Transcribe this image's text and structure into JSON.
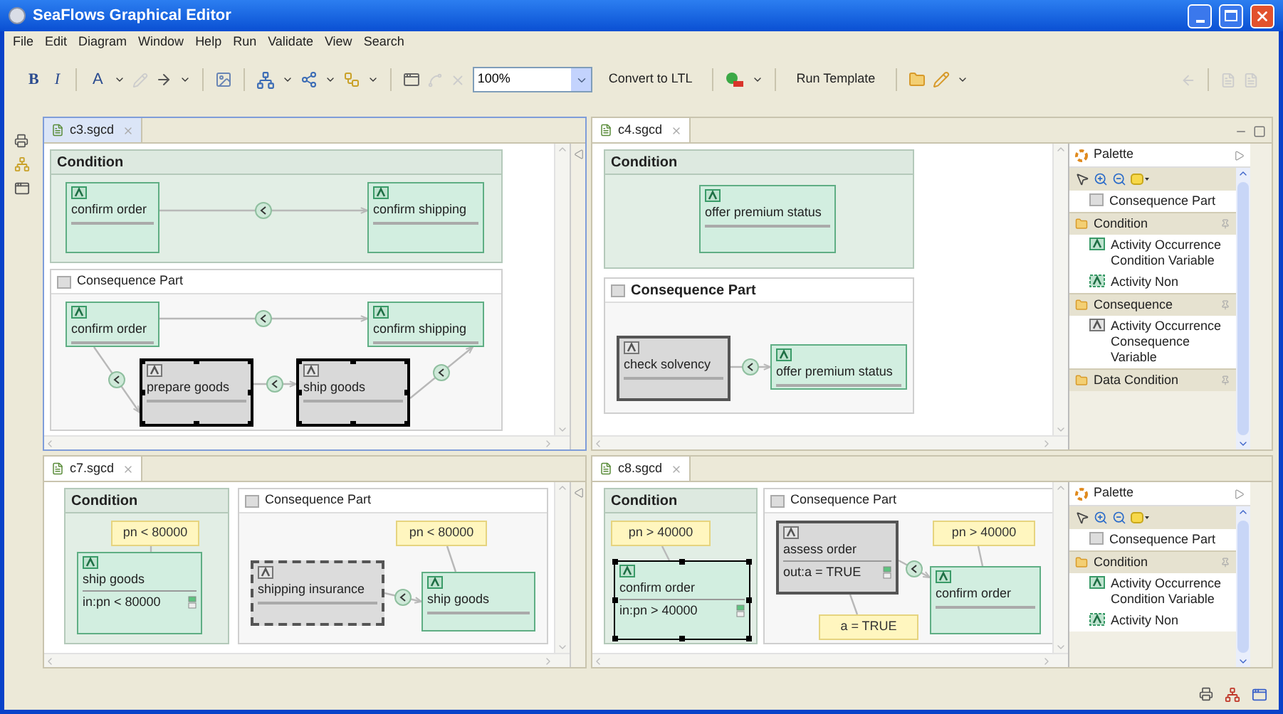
{
  "window": {
    "title": "SeaFlows Graphical Editor"
  },
  "menu": [
    {
      "label": "File"
    },
    {
      "label": "Edit"
    },
    {
      "label": "Diagram"
    },
    {
      "label": "Window"
    },
    {
      "label": "Help"
    },
    {
      "label": "Run"
    },
    {
      "label": "Validate"
    },
    {
      "label": "View"
    },
    {
      "label": "Search"
    }
  ],
  "toolbar": {
    "bold": "B",
    "italic": "I",
    "font_color": "A",
    "zoom": "100%",
    "convert": "Convert to LTL",
    "run": "Run Template"
  },
  "editors": [
    {
      "tab": "c3.sgcd",
      "active": true,
      "condition": {
        "title": "Condition",
        "items": [
          {
            "kind": "condition_activity",
            "label": "confirm order",
            "selected": false
          },
          {
            "kind": "condition_activity",
            "label": "confirm shipping",
            "selected": false
          }
        ]
      },
      "consequence": {
        "title": "Consequence Part",
        "items": [
          {
            "kind": "condition_activity",
            "label": "confirm order",
            "selected": false
          },
          {
            "kind": "condition_activity",
            "label": "confirm shipping",
            "selected": false
          },
          {
            "kind": "consequence_activity",
            "label": "prepare goods",
            "selected": true
          },
          {
            "kind": "consequence_activity",
            "label": "ship goods",
            "selected": true
          }
        ]
      }
    },
    {
      "tab": "c4.sgcd",
      "active": false,
      "condition": {
        "title": "Condition",
        "items": [
          {
            "kind": "condition_activity",
            "label": "offer premium status",
            "selected": false
          }
        ]
      },
      "consequence": {
        "title": "Consequence Part",
        "items": [
          {
            "kind": "consequence_activity",
            "label": "check solvency",
            "selected": false
          },
          {
            "kind": "condition_activity",
            "label": "offer premium status",
            "selected": false
          }
        ]
      },
      "palette": {
        "title": "Palette",
        "entries": [
          {
            "kind": "part",
            "label": "Consequence Part"
          },
          {
            "kind": "drawer",
            "label": "Condition"
          },
          {
            "kind": "condition_activity",
            "label": "Activity Occurrence Condition Variable"
          },
          {
            "kind": "non_occurrence",
            "label": "Activity Non"
          },
          {
            "kind": "drawer",
            "label": "Consequence"
          },
          {
            "kind": "consequence_activity",
            "label": "Activity Occurrence Consequence Variable"
          },
          {
            "kind": "drawer",
            "label": "Data Condition"
          }
        ]
      }
    },
    {
      "tab": "c7.sgcd",
      "active": false,
      "condition": {
        "title": "Condition",
        "items": [
          {
            "kind": "note",
            "text": "pn < 80000"
          },
          {
            "kind": "condition_activity",
            "label": "ship goods",
            "constraint": "in:pn < 80000",
            "selected": false
          }
        ]
      },
      "consequence": {
        "title": "Consequence Part",
        "items": [
          {
            "kind": "note",
            "text": "pn < 80000"
          },
          {
            "kind": "non_occurrence_activity",
            "label": "shipping insurance",
            "selected": false
          },
          {
            "kind": "condition_activity",
            "label": "ship goods",
            "selected": false
          }
        ]
      }
    },
    {
      "tab": "c8.sgcd",
      "active": false,
      "condition": {
        "title": "Condition",
        "items": [
          {
            "kind": "note",
            "text": "pn > 40000"
          },
          {
            "kind": "condition_activity",
            "label": "confirm order",
            "constraint": "in:pn > 40000",
            "selected": true
          }
        ]
      },
      "consequence": {
        "title": "Consequence Part",
        "items": [
          {
            "kind": "consequence_activity",
            "label": "assess order",
            "constraint": "out:a = TRUE",
            "selected": false
          },
          {
            "kind": "note",
            "text": "pn > 40000"
          },
          {
            "kind": "condition_activity",
            "label": "confirm order",
            "selected": false
          },
          {
            "kind": "note",
            "text": "a = TRUE"
          }
        ]
      },
      "palette": {
        "title": "Palette",
        "entries": [
          {
            "kind": "part",
            "label": "Consequence Part"
          },
          {
            "kind": "drawer",
            "label": "Condition"
          },
          {
            "kind": "condition_activity",
            "label": "Activity Occurrence Condition Variable"
          },
          {
            "kind": "non_occurrence",
            "label": "Activity Non"
          }
        ]
      }
    }
  ]
}
